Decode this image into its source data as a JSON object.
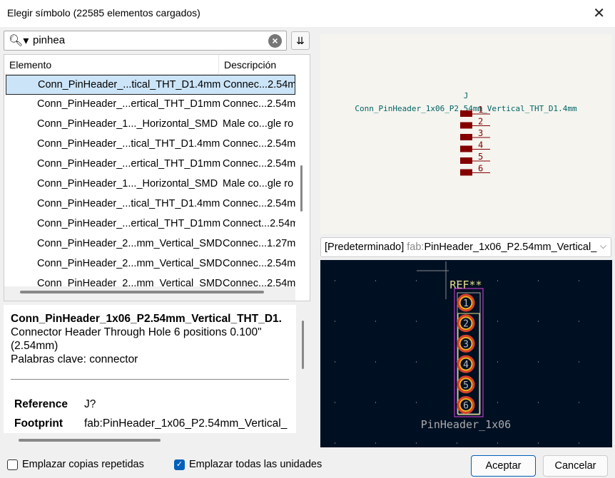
{
  "window": {
    "title": "Elegir símbolo (22585 elementos cargados)",
    "close_icon": "close-icon"
  },
  "search": {
    "value": "pinhea",
    "icon": "search-icon"
  },
  "table": {
    "headers": [
      "Elemento",
      "Descripción"
    ],
    "rows": [
      [
        "Conn_PinHeader_...tical_THT_D1.4mm",
        "Connec...2.54mm"
      ],
      [
        "Conn_PinHeader_...ertical_THT_D1mm",
        "Connec...2.54mm"
      ],
      [
        "Conn_PinHeader_1..._Horizontal_SMD",
        "Male co...gle ro"
      ],
      [
        "Conn_PinHeader_...tical_THT_D1.4mm",
        "Connec...2.54mm"
      ],
      [
        "Conn_PinHeader_...ertical_THT_D1mm",
        "Connec...2.54mm"
      ],
      [
        "Conn_PinHeader_1..._Horizontal_SMD",
        "Male co...gle ro"
      ],
      [
        "Conn_PinHeader_...tical_THT_D1.4mm",
        "Connec...2.54mm"
      ],
      [
        "Conn_PinHeader_...ertical_THT_D1mm",
        "Connect...2.54mm"
      ],
      [
        "Conn_PinHeader_2...mm_Vertical_SMD",
        "Connec...1.27mm"
      ],
      [
        "Conn_PinHeader_2...mm_Vertical_SMD",
        "Connec...2.54mm"
      ],
      [
        "Conn_PinHeader_2...mm_Vertical_SMD",
        "Connec...2.54mm"
      ]
    ],
    "selected_index": 0
  },
  "info": {
    "title": "Conn_PinHeader_1x06_P2.54mm_Vertical_THT_D1.",
    "description": "Connector Header Through Hole 6 positions 0.100\" (2.54mm)",
    "keywords": "Palabras clave: connector",
    "props": [
      {
        "label": "Reference",
        "value": "J?"
      },
      {
        "label": "Footprint",
        "value": "fab:PinHeader_1x06_P2.54mm_Vertical_"
      }
    ]
  },
  "symbol": {
    "reference": "J",
    "value": "Conn_PinHeader_1x06_P2.54mm_Vertical_THT_D1.4mm",
    "pins": [
      "1",
      "2",
      "3",
      "4",
      "5",
      "6"
    ],
    "pin_color": "#840000",
    "text_color": "#006464"
  },
  "footprint_select": {
    "prefix": "[Predeterminado]",
    "library": "fab:",
    "name": "PinHeader_1x06_P2.54mm_Vertical_"
  },
  "footprint": {
    "reference": "REF**",
    "value": "PinHeader_1x06",
    "pads": [
      "1",
      "2",
      "3",
      "4",
      "5",
      "6"
    ],
    "bg": "#001023"
  },
  "options": {
    "repeat_label": "Emplazar copias repetidas",
    "repeat_checked": false,
    "all_units_label": "Emplazar todas las unidades",
    "all_units_checked": true
  },
  "buttons": {
    "ok": "Aceptar",
    "cancel": "Cancelar"
  }
}
